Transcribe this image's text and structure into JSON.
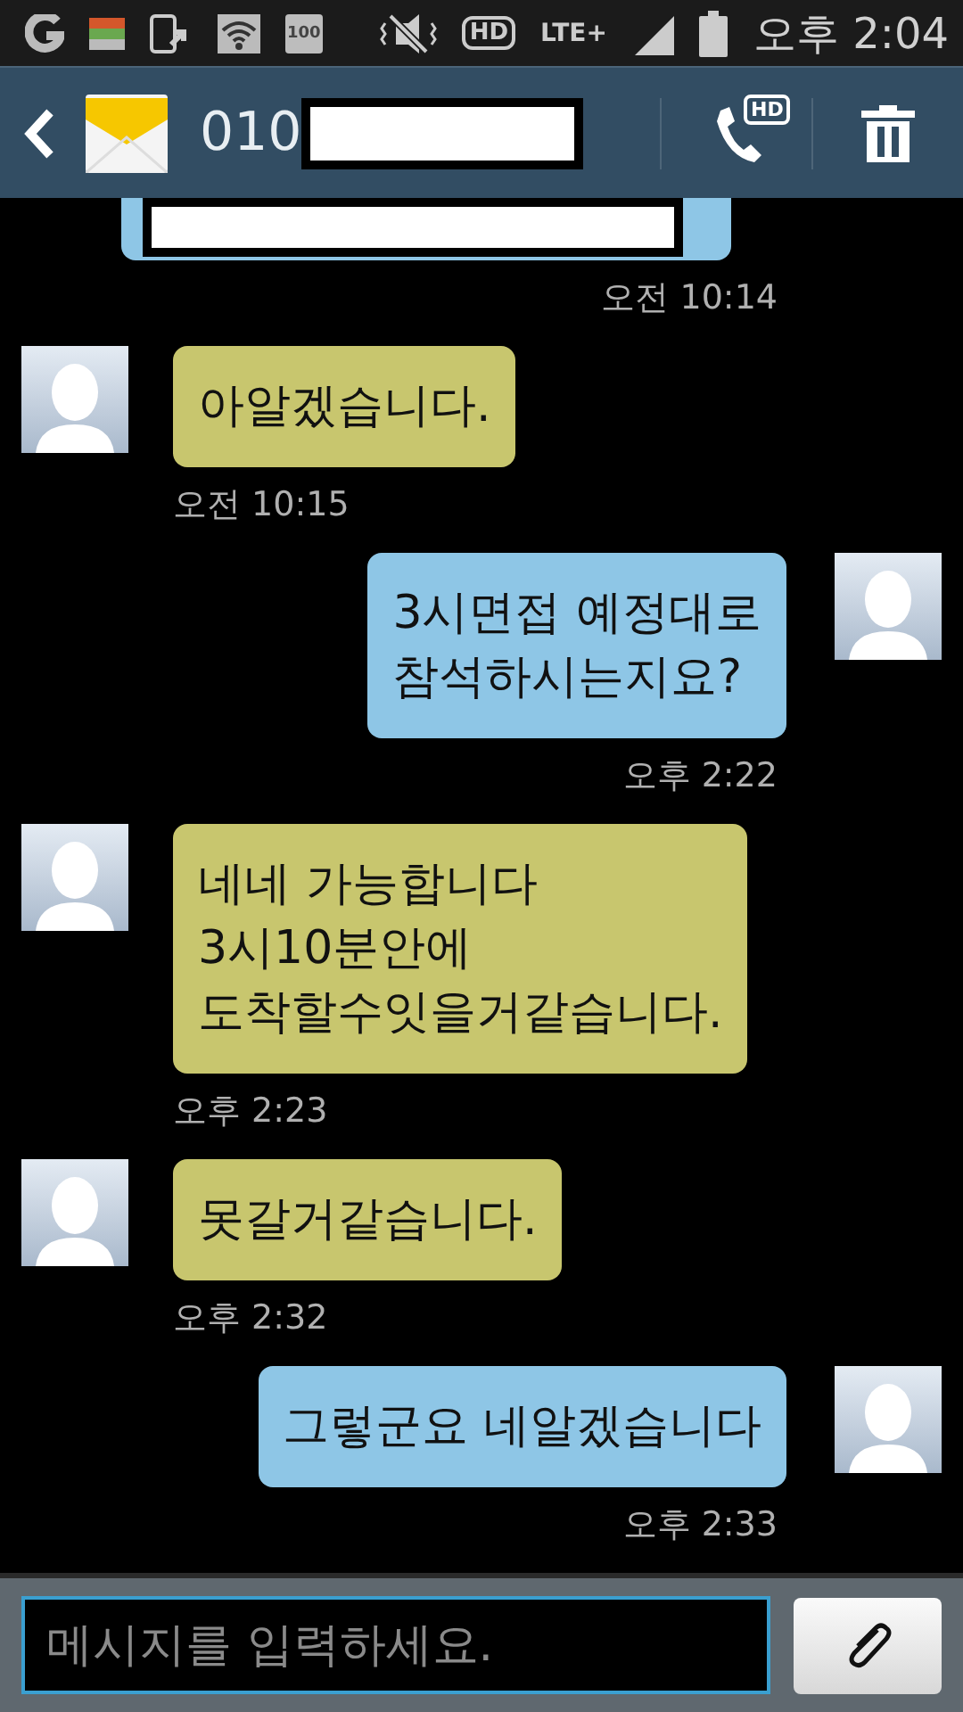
{
  "status_bar": {
    "battery_small": "100",
    "hd": "HD",
    "network": "LTE+",
    "time": "오후 2:04"
  },
  "header": {
    "contact": "010",
    "call_badge": "HD"
  },
  "messages": [
    {
      "kind": "sent",
      "time": "오전 10:14"
    },
    {
      "kind": "received",
      "text": "아알겠습니다.",
      "time": "오전 10:15"
    },
    {
      "kind": "sent",
      "text": "3시면접 예정대로\n참석하시는지요?",
      "time": "오후 2:22"
    },
    {
      "kind": "received",
      "text": "네네 가능합니다\n3시10분안에\n도착할수잇을거같습니다.",
      "time": "오후 2:23"
    },
    {
      "kind": "received",
      "text": "못갈거같습니다.",
      "time": "오후 2:32"
    },
    {
      "kind": "sent",
      "text": "그렇군요 네알겠습니다",
      "time": "오후 2:33"
    }
  ],
  "composer": {
    "placeholder": "메시지를 입력하세요."
  }
}
